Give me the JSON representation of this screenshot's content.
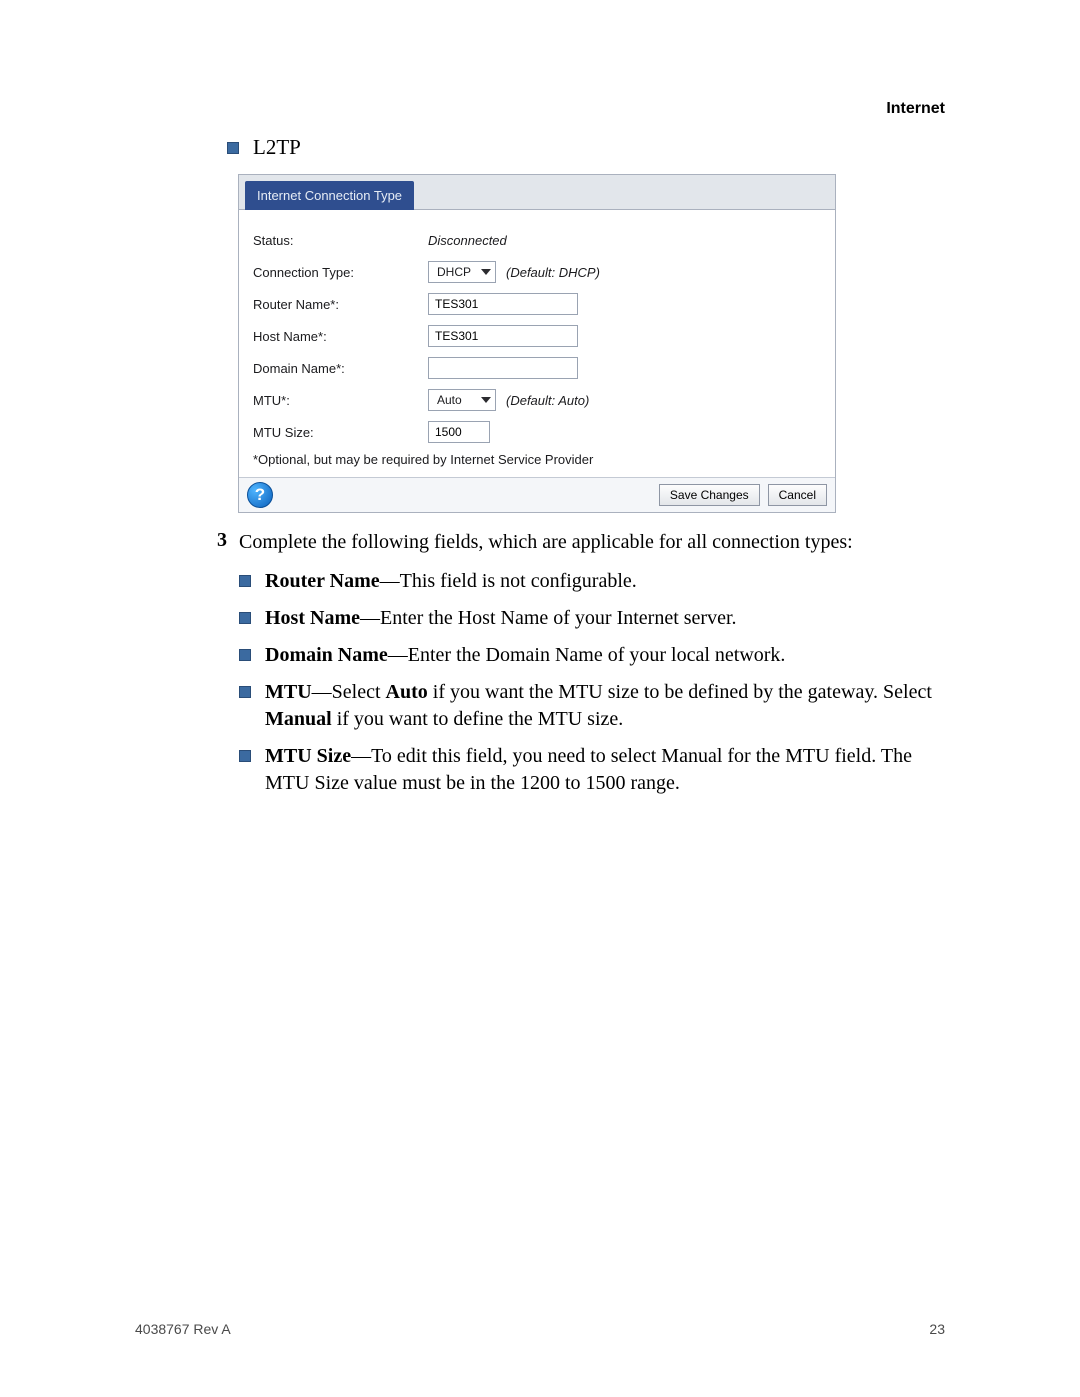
{
  "header": {
    "section": "Internet"
  },
  "top_bullet": {
    "label": "L2TP"
  },
  "screenshot": {
    "tab_label": "Internet Connection Type",
    "rows": {
      "status_label": "Status:",
      "status_value": "Disconnected",
      "conn_type_label": "Connection Type:",
      "conn_type_value": "DHCP",
      "conn_type_hint": "(Default: DHCP)",
      "router_name_label": "Router Name*:",
      "router_name_value": "TES301",
      "host_name_label": "Host Name*:",
      "host_name_value": "TES301",
      "domain_name_label": "Domain Name*:",
      "domain_name_value": "",
      "mtu_label": "MTU*:",
      "mtu_value": "Auto",
      "mtu_hint": "(Default: Auto)",
      "mtu_size_label": "MTU Size:",
      "mtu_size_value": "1500"
    },
    "footnote": "*Optional, but may be required by Internet Service Provider",
    "help_glyph": "?",
    "save_label": "Save Changes",
    "cancel_label": "Cancel"
  },
  "step": {
    "number": "3",
    "intro": "Complete the following fields, which are applicable for all connection types:",
    "bullets": {
      "b1_bold": "Router Name",
      "b1_rest": "—This field is not configurable.",
      "b2_bold": "Host Name",
      "b2_rest": "—Enter the Host Name of your Internet server.",
      "b3_bold": "Domain Name",
      "b3_rest": "—Enter the Domain Name of your local network.",
      "b4_bold1": "MTU",
      "b4_mid1": "—Select ",
      "b4_bold2": "Auto",
      "b4_mid2": " if you want the MTU size to be defined by the gateway. Select ",
      "b4_bold3": "Manual",
      "b4_mid3": " if you want to define the MTU size.",
      "b5_bold": "MTU Size",
      "b5_rest": "—To edit this field, you need to select Manual for the MTU field. The MTU Size value must be in the 1200 to 1500 range."
    }
  },
  "footer": {
    "left": "4038767 Rev A",
    "right": "23"
  }
}
